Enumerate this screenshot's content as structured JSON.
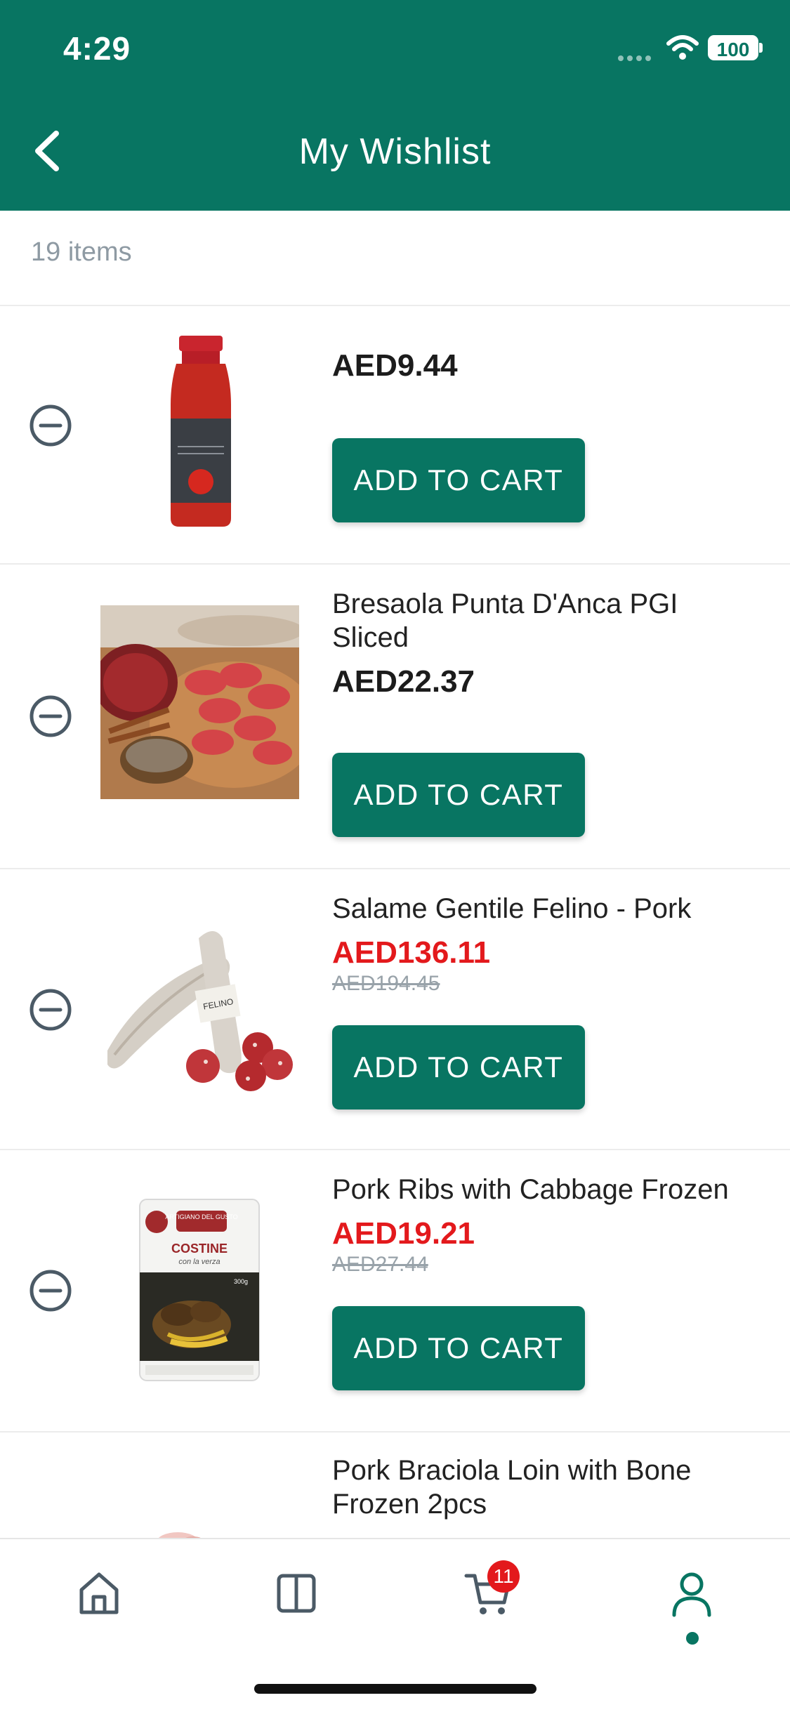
{
  "status_bar": {
    "time": "4:29",
    "battery": "100"
  },
  "header": {
    "title": "My Wishlist"
  },
  "wishlist": {
    "count_label": "19 items",
    "items": [
      {
        "name": "",
        "price": "AED9.44",
        "old_price": "",
        "button_label": "ADD TO CART",
        "image": "tomato-passata-bottle"
      },
      {
        "name": "Bresaola Punta D'Anca PGI Sliced",
        "price": "AED22.37",
        "old_price": "",
        "button_label": "ADD TO CART",
        "image": "bresaola-sliced"
      },
      {
        "name": "Salame Gentile Felino - Pork",
        "price": "AED136.11",
        "old_price": "AED194.45",
        "button_label": "ADD TO CART",
        "image": "salame-felino"
      },
      {
        "name": "Pork Ribs with Cabbage Frozen",
        "price": "AED19.21",
        "old_price": "AED27.44",
        "button_label": "ADD TO CART",
        "image": "pork-ribs-package"
      },
      {
        "name": "Pork Braciola Loin with Bone Frozen 2pcs",
        "price": "",
        "old_price": "",
        "button_label": "",
        "image": "pork-braciola"
      }
    ]
  },
  "package_label": {
    "brand": "ARTIGIANO DEL GUSTO",
    "product": "COSTINE",
    "sub": "con la verza",
    "weight": "300g"
  },
  "bottom_nav": {
    "items": [
      {
        "icon": "home-icon"
      },
      {
        "icon": "catalog-icon"
      },
      {
        "icon": "cart-icon"
      },
      {
        "icon": "account-icon"
      }
    ],
    "cart_badge": "11",
    "active": "account"
  },
  "colors": {
    "brand": "#087562",
    "sale": "#e3191c",
    "muted": "#98a2a9"
  }
}
